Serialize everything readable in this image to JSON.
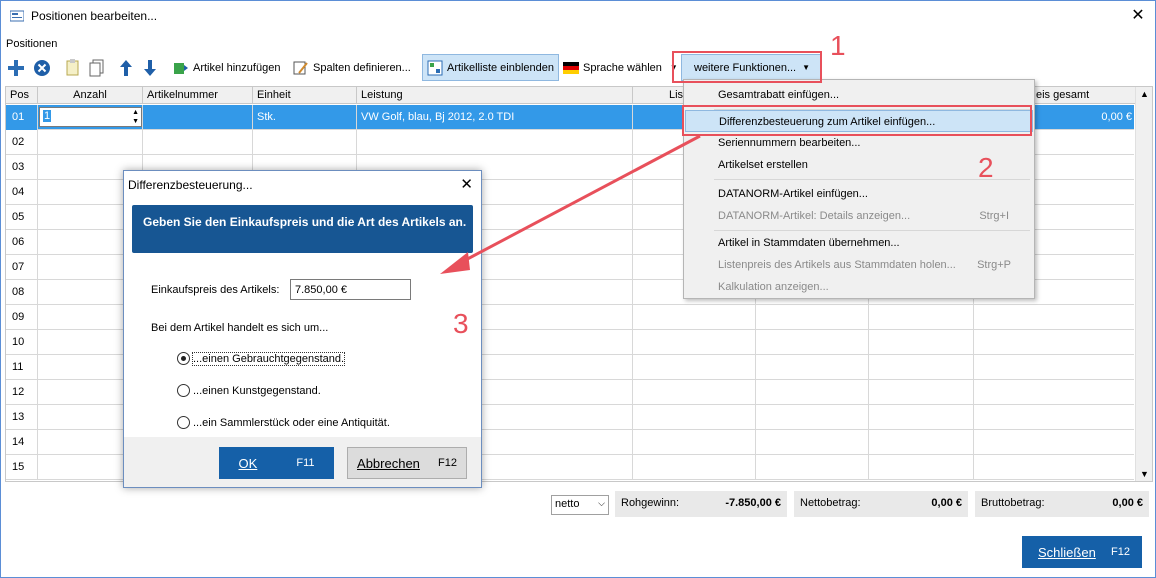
{
  "window": {
    "title": "Positionen bearbeiten..."
  },
  "section_label": "Positionen",
  "toolbar": {
    "add_article": "Artikel hinzufügen",
    "define_columns": "Spalten definieren...",
    "article_list": "Artikelliste einblenden",
    "language": "Sprache wählen",
    "more_functions": "weitere Funktionen..."
  },
  "grid": {
    "headers": [
      "Pos",
      "Anzahl",
      "Artikelnummer",
      "Einheit",
      "Leistung",
      "List",
      "eis gesamt"
    ],
    "rows": [
      "01",
      "02",
      "03",
      "04",
      "05",
      "06",
      "07",
      "08",
      "09",
      "10",
      "11",
      "12",
      "13",
      "14",
      "15"
    ],
    "row1": {
      "anzahl": "1",
      "einheit": "Stk.",
      "leistung": "VW Golf, blau, Bj 2012, 2.0 TDI",
      "gesamt": "0,00 €"
    }
  },
  "menu": {
    "items": [
      {
        "label": "Gesamtrabatt einfügen...",
        "shortcut": ""
      },
      {
        "label": "Differenzbesteuerung zum Artikel einfügen...",
        "shortcut": ""
      },
      {
        "label": "Seriennummern bearbeiten...",
        "shortcut": ""
      },
      {
        "label": "Artikelset erstellen",
        "shortcut": ""
      },
      {
        "label": "DATANORM-Artikel einfügen...",
        "shortcut": ""
      },
      {
        "label": "DATANORM-Artikel: Details anzeigen...",
        "shortcut": "Strg+I"
      },
      {
        "label": "Artikel in Stammdaten übernehmen...",
        "shortcut": ""
      },
      {
        "label": "Listenpreis des Artikels aus Stammdaten holen...",
        "shortcut": "Strg+P"
      },
      {
        "label": "Kalkulation anzeigen...",
        "shortcut": ""
      }
    ]
  },
  "dialog": {
    "title": "Differenzbesteuerung...",
    "banner": "Geben Sie den Einkaufspreis und die Art des Artikels an.",
    "price_label": "Einkaufspreis des Artikels:",
    "price_value": "7.850,00 €",
    "question": "Bei dem Artikel handelt es sich um...",
    "options": [
      "...einen Gebrauchtgegenstand.",
      "...einen Kunstgegenstand.",
      "...ein Sammlerstück oder eine Antiquität."
    ],
    "ok_label": "OK",
    "ok_key": "F11",
    "cancel_label": "Abbrechen",
    "cancel_key": "F12"
  },
  "summary": {
    "mode": "netto",
    "rohgewinn_label": "Rohgewinn:",
    "rohgewinn_value": "-7.850,00 €",
    "netto_label": "Nettobetrag:",
    "netto_value": "0,00 €",
    "brutto_label": "Bruttobetrag:",
    "brutto_value": "0,00 €"
  },
  "close_button": {
    "label": "Schließen",
    "key": "F12"
  },
  "annotations": [
    "1",
    "2",
    "3"
  ],
  "colors": {
    "accent": "#1560a8",
    "annotation": "#e8505b",
    "selection": "#3399e8"
  }
}
